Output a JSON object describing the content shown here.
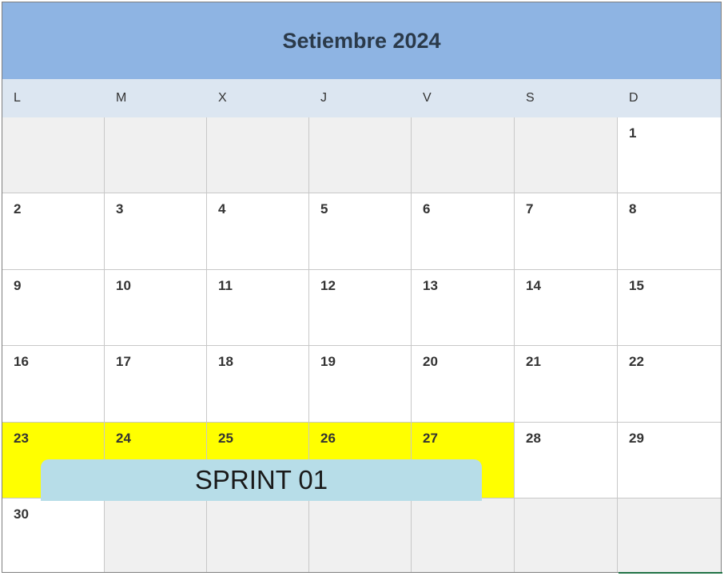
{
  "calendar": {
    "title": "Setiembre 2024",
    "weekdays": [
      "L",
      "M",
      "X",
      "J",
      "V",
      "S",
      "D"
    ],
    "weeks": [
      [
        "",
        "",
        "",
        "",
        "",
        "",
        "1"
      ],
      [
        "2",
        "3",
        "4",
        "5",
        "6",
        "7",
        "8"
      ],
      [
        "9",
        "10",
        "11",
        "12",
        "13",
        "14",
        "15"
      ],
      [
        "16",
        "17",
        "18",
        "19",
        "20",
        "21",
        "22"
      ],
      [
        "23",
        "24",
        "25",
        "26",
        "27",
        "28",
        "29"
      ],
      [
        "30",
        "",
        "",
        "",
        "",
        "",
        ""
      ]
    ],
    "highlight_color": "#ffff00",
    "header_color": "#8eb4e3",
    "weekday_row_color": "#dce6f1"
  },
  "sprint": {
    "label": "SPRINT 01",
    "days": [
      "23",
      "24",
      "25",
      "26",
      "27"
    ],
    "color": "#b7dde8"
  }
}
